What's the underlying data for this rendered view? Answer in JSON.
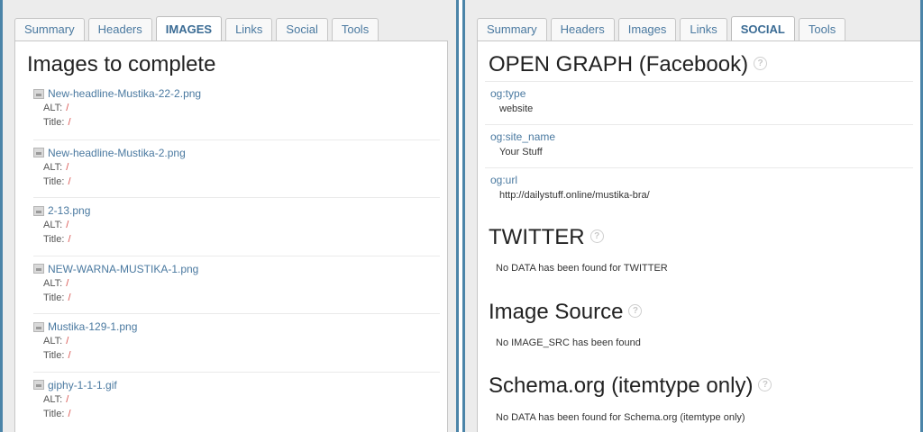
{
  "left": {
    "tabs": [
      "Summary",
      "Headers",
      "IMAGES",
      "Links",
      "Social",
      "Tools"
    ],
    "active_tab": 2,
    "title": "Images to complete",
    "alt_label": "ALT:",
    "title_label": "Title:",
    "images": [
      {
        "name": "New-headline-Mustika-22-2.png",
        "alt": "/",
        "title": "/"
      },
      {
        "name": "New-headline-Mustika-2.png",
        "alt": "/",
        "title": "/"
      },
      {
        "name": "2-13.png",
        "alt": "/",
        "title": "/"
      },
      {
        "name": "NEW-WARNA-MUSTIKA-1.png",
        "alt": "/",
        "title": "/"
      },
      {
        "name": "Mustika-129-1.png",
        "alt": "/",
        "title": "/"
      },
      {
        "name": "giphy-1-1-1.gif",
        "alt": "/",
        "title": "/"
      }
    ]
  },
  "right": {
    "tabs": [
      "Summary",
      "Headers",
      "Images",
      "Links",
      "SOCIAL",
      "Tools"
    ],
    "active_tab": 4,
    "help_glyph": "?",
    "og_title": "OPEN GRAPH (Facebook)",
    "og_items": [
      {
        "key": "og:type",
        "value": "website"
      },
      {
        "key": "og:site_name",
        "value": "Your Stuff"
      },
      {
        "key": "og:url",
        "value": "http://dailystuff.online/mustika-bra/"
      }
    ],
    "twitter_title": "TWITTER",
    "twitter_msg": "No DATA has been found for TWITTER",
    "image_source_title": "Image Source",
    "image_source_msg": "No IMAGE_SRC has been found",
    "schema_title": "Schema.org (itemtype only)",
    "schema_msg": "No DATA has been found for Schema.org (itemtype only)"
  },
  "colors": {
    "frame": "#4b84a8",
    "link": "#4a79a0",
    "missing": "#d9534f"
  },
  "icons": {
    "help": "help-circle-icon",
    "image": "image-file-icon"
  }
}
